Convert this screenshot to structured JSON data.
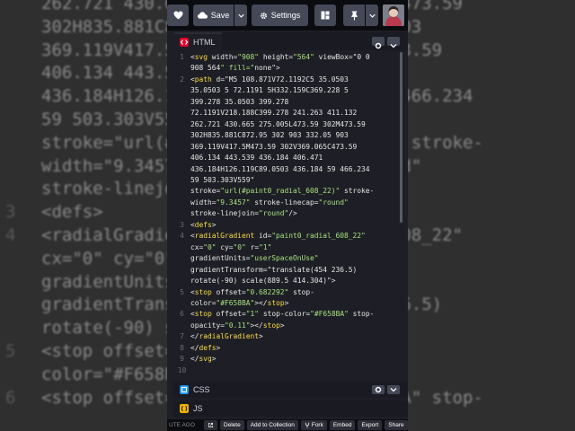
{
  "toolbar": {
    "save_label": "Save",
    "settings_label": "Settings"
  },
  "editors": {
    "html": {
      "label": "HTML",
      "icon": "html-icon",
      "color": "#e4002b"
    },
    "css": {
      "label": "CSS",
      "icon": "css-icon",
      "color": "#2196f3"
    },
    "js": {
      "label": "JS",
      "icon": "js-icon",
      "color": "#f0b400"
    }
  },
  "code_lines": [
    {
      "n": "1",
      "html": "&lt;svg width=\"908\" height=\"564\" viewBox=\"0 0"
    },
    {
      "n": "",
      "html": "908 564\" fill=\"none\"&gt;"
    },
    {
      "n": "2",
      "html": "&lt;path d=\"M5 108.871V72.1192C5 35.0503"
    },
    {
      "n": "",
      "html": "35.0503 5 72.1191 5H332.159C369.228 5"
    },
    {
      "n": "",
      "html": "399.278 35.0503 399.278"
    },
    {
      "n": "",
      "html": "72.1191V218.188C399.278 241.263 411.132"
    },
    {
      "n": "",
      "html": "262.721 430.665 275.005L473.59 302M473.59"
    },
    {
      "n": "",
      "html": "302H835.881C872.95 302 903 332.05 903"
    },
    {
      "n": "",
      "html": "369.119V417.5M473.59 302V369.065C473.59"
    },
    {
      "n": "",
      "html": "406.134 443.539 436.184 406.471"
    },
    {
      "n": "",
      "html": "436.184H126.119C89.0503 436.184 59 466.234"
    },
    {
      "n": "",
      "html": "59 503.303V559\""
    },
    {
      "n": "",
      "html": "stroke=\"url(#paint0_radial_608_22)\" stroke-"
    },
    {
      "n": "",
      "html": "width=\"9.3457\" stroke-linecap=\"round\""
    },
    {
      "n": "",
      "html": "stroke-linejoin=\"round\"/&gt;"
    },
    {
      "n": "3",
      "html": "&lt;defs&gt;"
    },
    {
      "n": "4",
      "html": "&lt;radialGradient id=\"paint0_radial_608_22\""
    },
    {
      "n": "",
      "html": "cx=\"0\" cy=\"0\" r=\"1\""
    },
    {
      "n": "",
      "html": "gradientUnits=\"userSpaceOnUse\""
    },
    {
      "n": "",
      "html": "gradientTransform=\"translate(454 236.5)"
    },
    {
      "n": "",
      "html": "rotate(-90) scale(889.5 414.304)\"&gt;"
    },
    {
      "n": "5",
      "html": "&lt;stop offset=\"0.682292\" stop-"
    },
    {
      "n": "",
      "html": "color=\"#F658BA\"&gt;&lt;/stop&gt;"
    },
    {
      "n": "6",
      "html": "&lt;stop offset=\"1\" stop-color=\"#F658BA\" stop-"
    },
    {
      "n": "",
      "html": "opacity=\"0.11\"&gt;&lt;/stop&gt;"
    },
    {
      "n": "7",
      "html": "&lt;/radialGradient&gt;"
    },
    {
      "n": "8",
      "html": "&lt;/defs&gt;"
    },
    {
      "n": "9",
      "html": "&lt;/svg&gt;"
    },
    {
      "n": "10",
      "html": ""
    }
  ],
  "background_lines": [
    {
      "n": "",
      "text": "262.721 430.665 275.005L473.59 302M473.59"
    },
    {
      "n": "",
      "text": "302H835.881C872.95 302 903 332.05 903"
    },
    {
      "n": "",
      "text": "369.119V417.5M473.59 302V369.065C473.59"
    },
    {
      "n": "",
      "text": "406.134 443.539 436.184 406.471"
    },
    {
      "n": "",
      "text": "436.184H126.119C89.0503 436.184 59 466.234"
    },
    {
      "n": "",
      "text": "59 503.303V559\""
    },
    {
      "n": "",
      "text": "stroke=\"url(#paint0_radial_608_22)\" stroke-"
    },
    {
      "n": "",
      "text": "width=\"9.3457\" stroke-linecap=\"round\""
    },
    {
      "n": "",
      "text": "stroke-linejoin=\"round\"/>"
    },
    {
      "n": "3",
      "text": "<defs>"
    },
    {
      "n": "4",
      "text": "<radialGradient id=\"paint0_radial_608_22\""
    },
    {
      "n": "",
      "text": "cx=\"0\" cy=\"0\" r=\"1\""
    },
    {
      "n": "",
      "text": "gradientUnits=\"userSpaceOnUse\""
    },
    {
      "n": "",
      "text": "gradientTransform=\"translate(454 236.5)"
    },
    {
      "n": "",
      "text": "rotate(-90) scale(889.5 414.304)\">"
    },
    {
      "n": "5",
      "text": "<stop offset=\"0.682292\" stop-"
    },
    {
      "n": "",
      "text": "color=\"#F658BA\"></stop>"
    },
    {
      "n": "6",
      "text": "<stop offset=\"1\" stop-color=\"#F658BA\" stop-"
    }
  ],
  "footer": {
    "ago": "UTE AGO",
    "actions": [
      "Delete",
      "Add to Collection",
      "Fork",
      "Embed",
      "Export",
      "Share"
    ]
  }
}
